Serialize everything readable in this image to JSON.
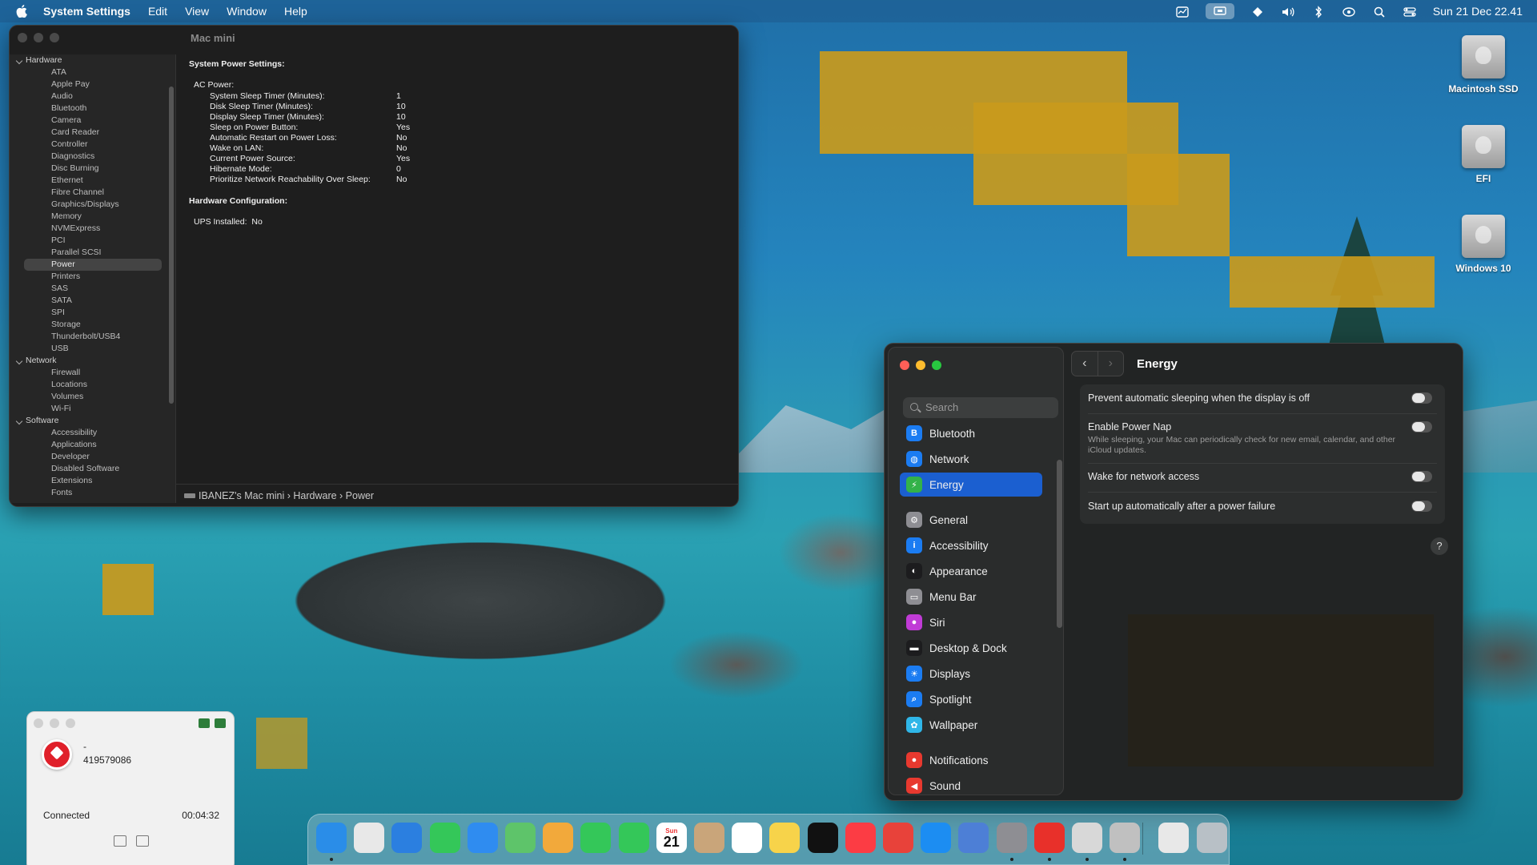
{
  "menubar": {
    "app_name": "System Settings",
    "menus": [
      "Edit",
      "View",
      "Window",
      "Help"
    ],
    "datetime": "Sun 21 Dec 22.41"
  },
  "desktop_icons": [
    {
      "label": "Macintosh SSD"
    },
    {
      "label": "EFI"
    },
    {
      "label": "Windows 10"
    }
  ],
  "system_information": {
    "window_title": "Mac mini",
    "tree": [
      {
        "type": "cat",
        "label": "Hardware"
      },
      {
        "type": "item",
        "label": "ATA"
      },
      {
        "type": "item",
        "label": "Apple Pay"
      },
      {
        "type": "item",
        "label": "Audio"
      },
      {
        "type": "item",
        "label": "Bluetooth"
      },
      {
        "type": "item",
        "label": "Camera"
      },
      {
        "type": "item",
        "label": "Card Reader"
      },
      {
        "type": "item",
        "label": "Controller"
      },
      {
        "type": "item",
        "label": "Diagnostics"
      },
      {
        "type": "item",
        "label": "Disc Burning"
      },
      {
        "type": "item",
        "label": "Ethernet"
      },
      {
        "type": "item",
        "label": "Fibre Channel"
      },
      {
        "type": "item",
        "label": "Graphics/Displays"
      },
      {
        "type": "item",
        "label": "Memory"
      },
      {
        "type": "item",
        "label": "NVMExpress"
      },
      {
        "type": "item",
        "label": "PCI"
      },
      {
        "type": "item",
        "label": "Parallel SCSI"
      },
      {
        "type": "item",
        "label": "Power",
        "selected": true
      },
      {
        "type": "item",
        "label": "Printers"
      },
      {
        "type": "item",
        "label": "SAS"
      },
      {
        "type": "item",
        "label": "SATA"
      },
      {
        "type": "item",
        "label": "SPI"
      },
      {
        "type": "item",
        "label": "Storage"
      },
      {
        "type": "item",
        "label": "Thunderbolt/USB4"
      },
      {
        "type": "item",
        "label": "USB"
      },
      {
        "type": "cat",
        "label": "Network"
      },
      {
        "type": "item",
        "label": "Firewall"
      },
      {
        "type": "item",
        "label": "Locations"
      },
      {
        "type": "item",
        "label": "Volumes"
      },
      {
        "type": "item",
        "label": "Wi-Fi"
      },
      {
        "type": "cat",
        "label": "Software"
      },
      {
        "type": "item",
        "label": "Accessibility"
      },
      {
        "type": "item",
        "label": "Applications"
      },
      {
        "type": "item",
        "label": "Developer"
      },
      {
        "type": "item",
        "label": "Disabled Software"
      },
      {
        "type": "item",
        "label": "Extensions"
      },
      {
        "type": "item",
        "label": "Fonts"
      }
    ],
    "content": {
      "heading": "System Power Settings:",
      "ac_power": "AC Power:",
      "rows": [
        {
          "k": "System Sleep Timer (Minutes):",
          "v": "1"
        },
        {
          "k": "Disk Sleep Timer (Minutes):",
          "v": "10"
        },
        {
          "k": "Display Sleep Timer (Minutes):",
          "v": "10"
        },
        {
          "k": "Sleep on Power Button:",
          "v": "Yes"
        },
        {
          "k": "Automatic Restart on Power Loss:",
          "v": "No"
        },
        {
          "k": "Wake on LAN:",
          "v": "No"
        },
        {
          "k": "Current Power Source:",
          "v": "Yes"
        },
        {
          "k": "Hibernate Mode:",
          "v": "0"
        },
        {
          "k": "Prioritize Network Reachability Over Sleep:",
          "v": "No"
        }
      ],
      "hw_heading": "Hardware Configuration:",
      "ups": "UPS Installed:",
      "ups_value": "No"
    },
    "pathbar": "IBANEZ's Mac mini › Hardware › Power"
  },
  "settings": {
    "search_placeholder": "Search",
    "page_title": "Energy",
    "nav": [
      {
        "label": "Bluetooth",
        "color": "#1b7cf2",
        "glyph": "B"
      },
      {
        "label": "Network",
        "color": "#1b7cf2",
        "glyph": "◍"
      },
      {
        "label": "Energy",
        "color": "#33b249",
        "glyph": "⚡",
        "selected": true
      },
      {
        "label": "General",
        "color": "#8e8e93",
        "glyph": "⚙"
      },
      {
        "label": "Accessibility",
        "color": "#1b7cf2",
        "glyph": "i"
      },
      {
        "label": "Appearance",
        "color": "#1c1c1e",
        "glyph": "◐"
      },
      {
        "label": "Menu Bar",
        "color": "#8e8e93",
        "glyph": "▭"
      },
      {
        "label": "Siri",
        "color": "#c03bd6",
        "glyph": "●"
      },
      {
        "label": "Desktop & Dock",
        "color": "#1c1c1e",
        "glyph": "▬"
      },
      {
        "label": "Displays",
        "color": "#1b7cf2",
        "glyph": "☀"
      },
      {
        "label": "Spotlight",
        "color": "#1b7cf2",
        "glyph": "⌕"
      },
      {
        "label": "Wallpaper",
        "color": "#2fb6e8",
        "glyph": "✿"
      },
      {
        "label": "Notifications",
        "color": "#e8392f",
        "glyph": "●"
      },
      {
        "label": "Sound",
        "color": "#e8392f",
        "glyph": "◀"
      }
    ],
    "options": [
      {
        "label": "Prevent automatic sleeping when the display is off",
        "desc": "",
        "on": false
      },
      {
        "label": "Enable Power Nap",
        "desc": "While sleeping, your Mac can periodically check for new email, calendar, and other iCloud updates.",
        "on": false
      },
      {
        "label": "Wake for network access",
        "desc": "",
        "on": false
      },
      {
        "label": "Start up automatically after a power failure",
        "desc": "",
        "on": false
      }
    ],
    "help": "?"
  },
  "call_widget": {
    "name": "-",
    "number": "419579086",
    "status": "Connected",
    "duration": "00:04:32"
  },
  "dock": {
    "calendar_month": "Sun",
    "calendar_day": "21",
    "apps": [
      {
        "name": "finder-icon",
        "color": "#2a8de8",
        "running": true
      },
      {
        "name": "launchpad-icon",
        "color": "#e8e8e8"
      },
      {
        "name": "safari-icon",
        "color": "#2b7fe0"
      },
      {
        "name": "messages-icon",
        "color": "#34c759"
      },
      {
        "name": "mail-icon",
        "color": "#2f8cf0"
      },
      {
        "name": "maps-icon",
        "color": "#5ec46a"
      },
      {
        "name": "photos-icon",
        "color": "#f2a93b"
      },
      {
        "name": "facetime-icon",
        "color": "#34c759"
      },
      {
        "name": "phone-icon",
        "color": "#34c759"
      },
      {
        "name": "calendar-icon",
        "color": "#ffffff"
      },
      {
        "name": "contacts-icon",
        "color": "#c9a57a"
      },
      {
        "name": "reminders-icon",
        "color": "#ffffff"
      },
      {
        "name": "notes-icon",
        "color": "#f7d34a"
      },
      {
        "name": "tv-icon",
        "color": "#111111"
      },
      {
        "name": "music-icon",
        "color": "#fc3c44"
      },
      {
        "name": "rocket-icon",
        "color": "#e8423a"
      },
      {
        "name": "app-store-icon",
        "color": "#1c8df2"
      },
      {
        "name": "preview-icon",
        "color": "#4d7fd6"
      },
      {
        "name": "system-settings-icon",
        "color": "#8e8e93",
        "running": true
      },
      {
        "name": "anydesk-icon",
        "color": "#e8302a",
        "running": true
      },
      {
        "name": "script-editor-icon",
        "color": "#d8d8d8",
        "running": true
      },
      {
        "name": "system-information-icon",
        "color": "#c0c0c0",
        "running": true
      },
      {
        "name": "document-icon",
        "color": "#e8e8e8"
      },
      {
        "name": "trash-icon",
        "color": "#b8c0c6"
      }
    ]
  }
}
